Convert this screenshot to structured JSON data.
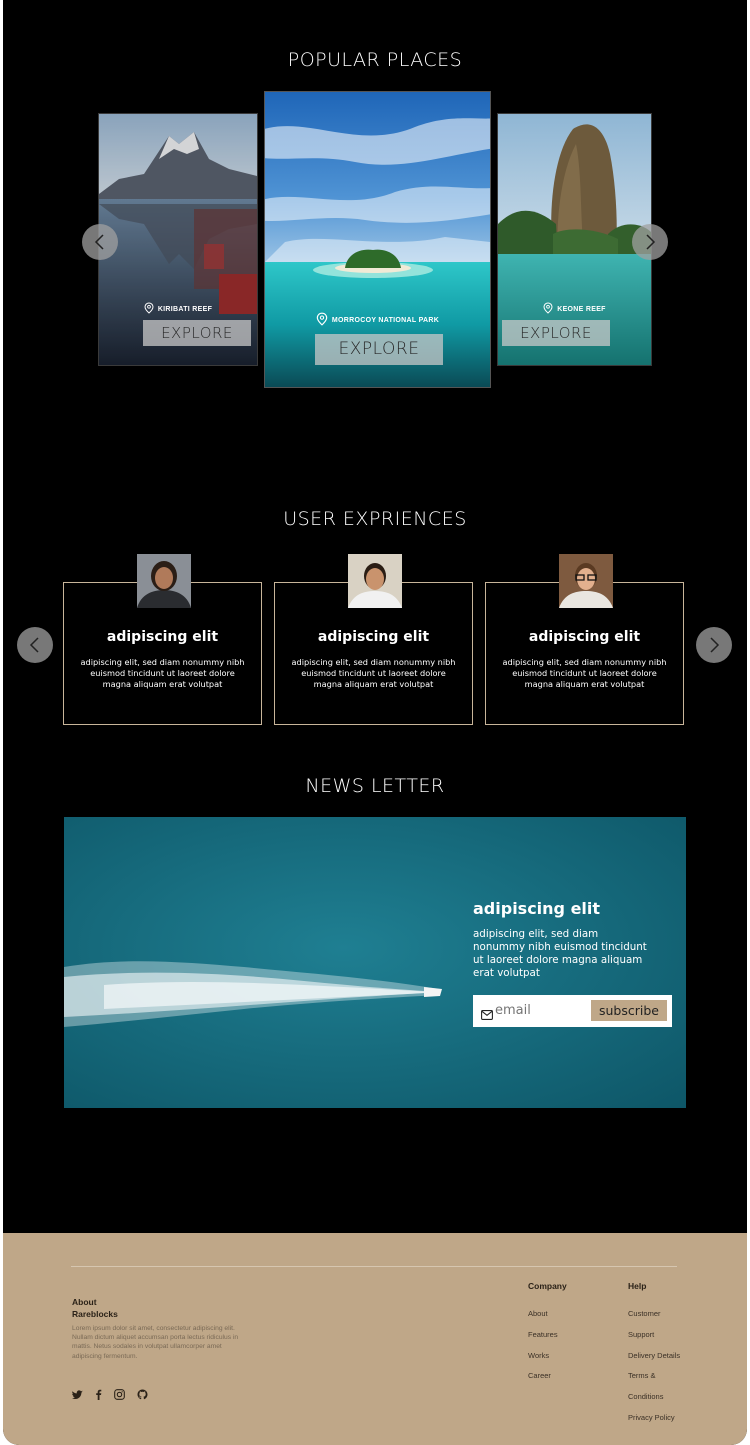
{
  "popular": {
    "title": "POPULAR PLACES",
    "cards": [
      {
        "location": "KIRIBATI REEF",
        "button": "EXPLORE"
      },
      {
        "location": "MORROCOY NATIONAL PARK",
        "button": "EXPLORE"
      },
      {
        "location": "KEONE REEF",
        "button": "EXPLORE"
      }
    ]
  },
  "experiences": {
    "title": "USER EXPRIENCES",
    "cards": [
      {
        "title": "adipiscing elit",
        "body": "adipiscing elit, sed diam nonummy nibh euismod tincidunt ut laoreet dolore magna aliquam erat volutpat"
      },
      {
        "title": "adipiscing elit",
        "body": "adipiscing elit, sed diam nonummy nibh euismod tincidunt ut laoreet dolore magna aliquam erat volutpat"
      },
      {
        "title": "adipiscing elit",
        "body": "adipiscing elit, sed diam nonummy nibh euismod tincidunt ut laoreet dolore magna aliquam erat volutpat"
      }
    ]
  },
  "newsletter": {
    "title": "NEWS LETTER",
    "heading": "adipiscing elit",
    "body": "adipiscing elit, sed diam nonummy nibh euismod tincidunt ut laoreet dolore magna aliquam erat volutpat",
    "email_placeholder": "email",
    "subscribe_label": "subscribe"
  },
  "footer": {
    "about_title": "About",
    "brand": "Rareblocks",
    "about_text": "Lorem ipsum dolor sit amet, consectetur adipiscing elit. Nullam dictum aliquet accumsan porta lectus ridiculus in mattis. Netus sodales in volutpat ullamcorper amet adipiscing fermentum.",
    "company_title": "Company",
    "company_links": [
      "About",
      "Features",
      "Works",
      "Career"
    ],
    "help_title": "Help",
    "help_links": [
      "Customer",
      "Support",
      "Delivery Details",
      "Terms &",
      "Conditions",
      "Privacy Policy"
    ],
    "social_icons": [
      "twitter-icon",
      "facebook-icon",
      "instagram-icon",
      "github-icon"
    ]
  },
  "colors": {
    "background": "#000000",
    "footer_bg": "#bfa788",
    "subscribe_bg": "#bfa788",
    "card_border": "#c8b59a"
  }
}
